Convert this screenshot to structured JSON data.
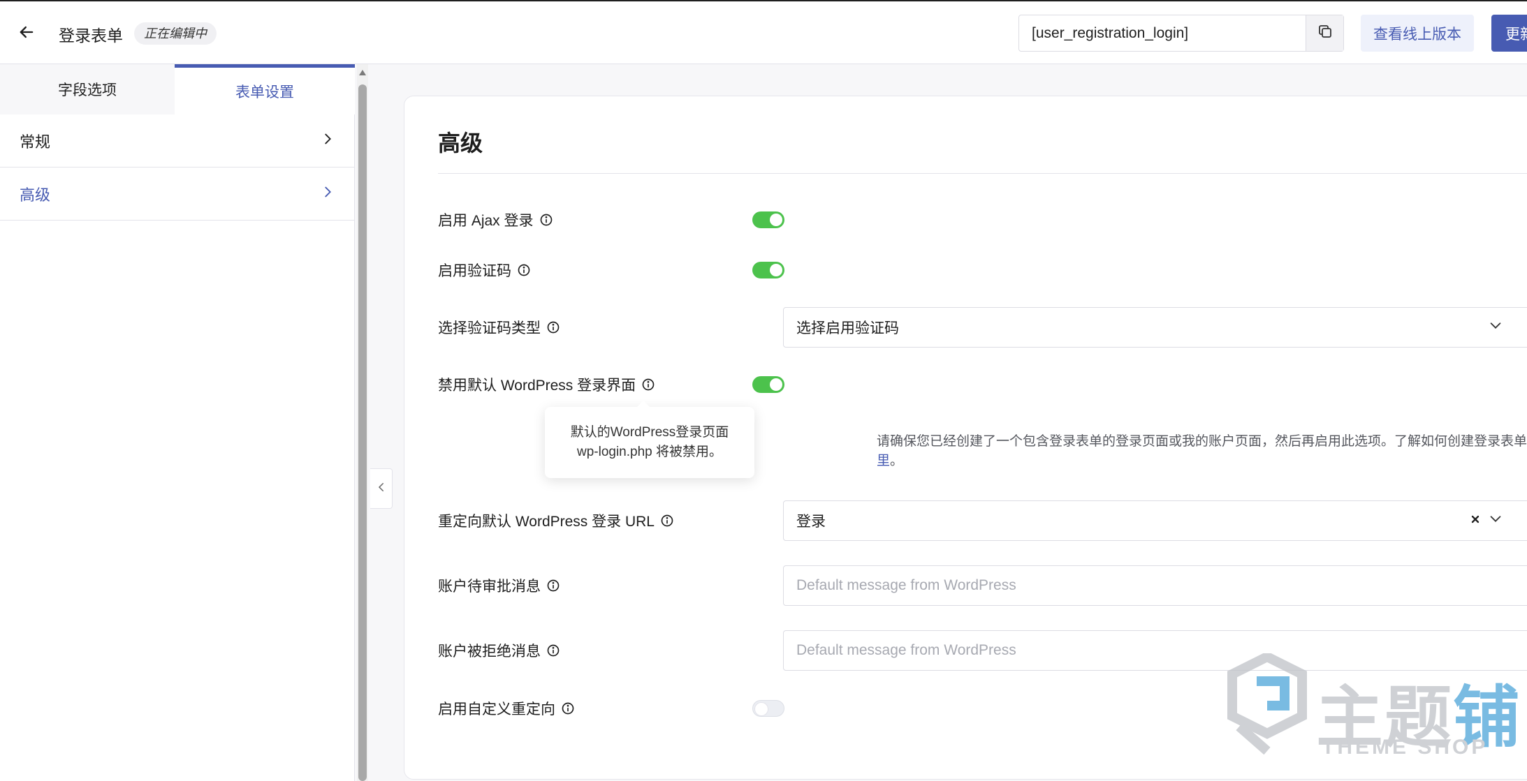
{
  "header": {
    "title": "登录表单",
    "status": "正在编辑中",
    "shortcode": "[user_registration_login]",
    "view_live_label": "查看线上版本",
    "update_label": "更新"
  },
  "sidebar": {
    "tabs": [
      {
        "label": "字段选项",
        "active": false
      },
      {
        "label": "表单设置",
        "active": true
      }
    ],
    "items": [
      {
        "label": "常规",
        "active": false
      },
      {
        "label": "高级",
        "active": true
      }
    ]
  },
  "panel": {
    "title": "高级",
    "rows": {
      "ajax_login": {
        "label": "启用 Ajax 登录",
        "enabled": true
      },
      "captcha": {
        "label": "启用验证码",
        "enabled": true
      },
      "captcha_type": {
        "label": "选择验证码类型",
        "value": "选择启用验证码"
      },
      "disable_default_login": {
        "label": "禁用默认 WordPress 登录界面",
        "enabled": true
      },
      "redirect_default_url": {
        "label": "重定向默认 WordPress 登录 URL",
        "value": "登录"
      },
      "pending_message": {
        "label": "账户待审批消息",
        "placeholder": "Default message from WordPress"
      },
      "denied_message": {
        "label": "账户被拒绝消息",
        "placeholder": "Default message from WordPress"
      },
      "custom_redirect": {
        "label": "启用自定义重定向",
        "enabled": false
      }
    },
    "help_text": {
      "prefix": "请确保您已经创建了一个包含登录表单的登录页面或我的账户页面，然后再启用此选项。了解如何创建登录表单",
      "link": "这里",
      "suffix": "。"
    },
    "tooltip": {
      "line1": "默认的WordPress登录页面",
      "line2": "wp-login.php 将被禁用。"
    }
  },
  "watermark": {
    "cn_prefix": "主题",
    "cn_suffix": "铺",
    "en": "THEME SHOP"
  },
  "colors": {
    "accent": "#475bb2",
    "toggle_on": "#4cc24c",
    "watermark_blue": "#4da5d9"
  }
}
